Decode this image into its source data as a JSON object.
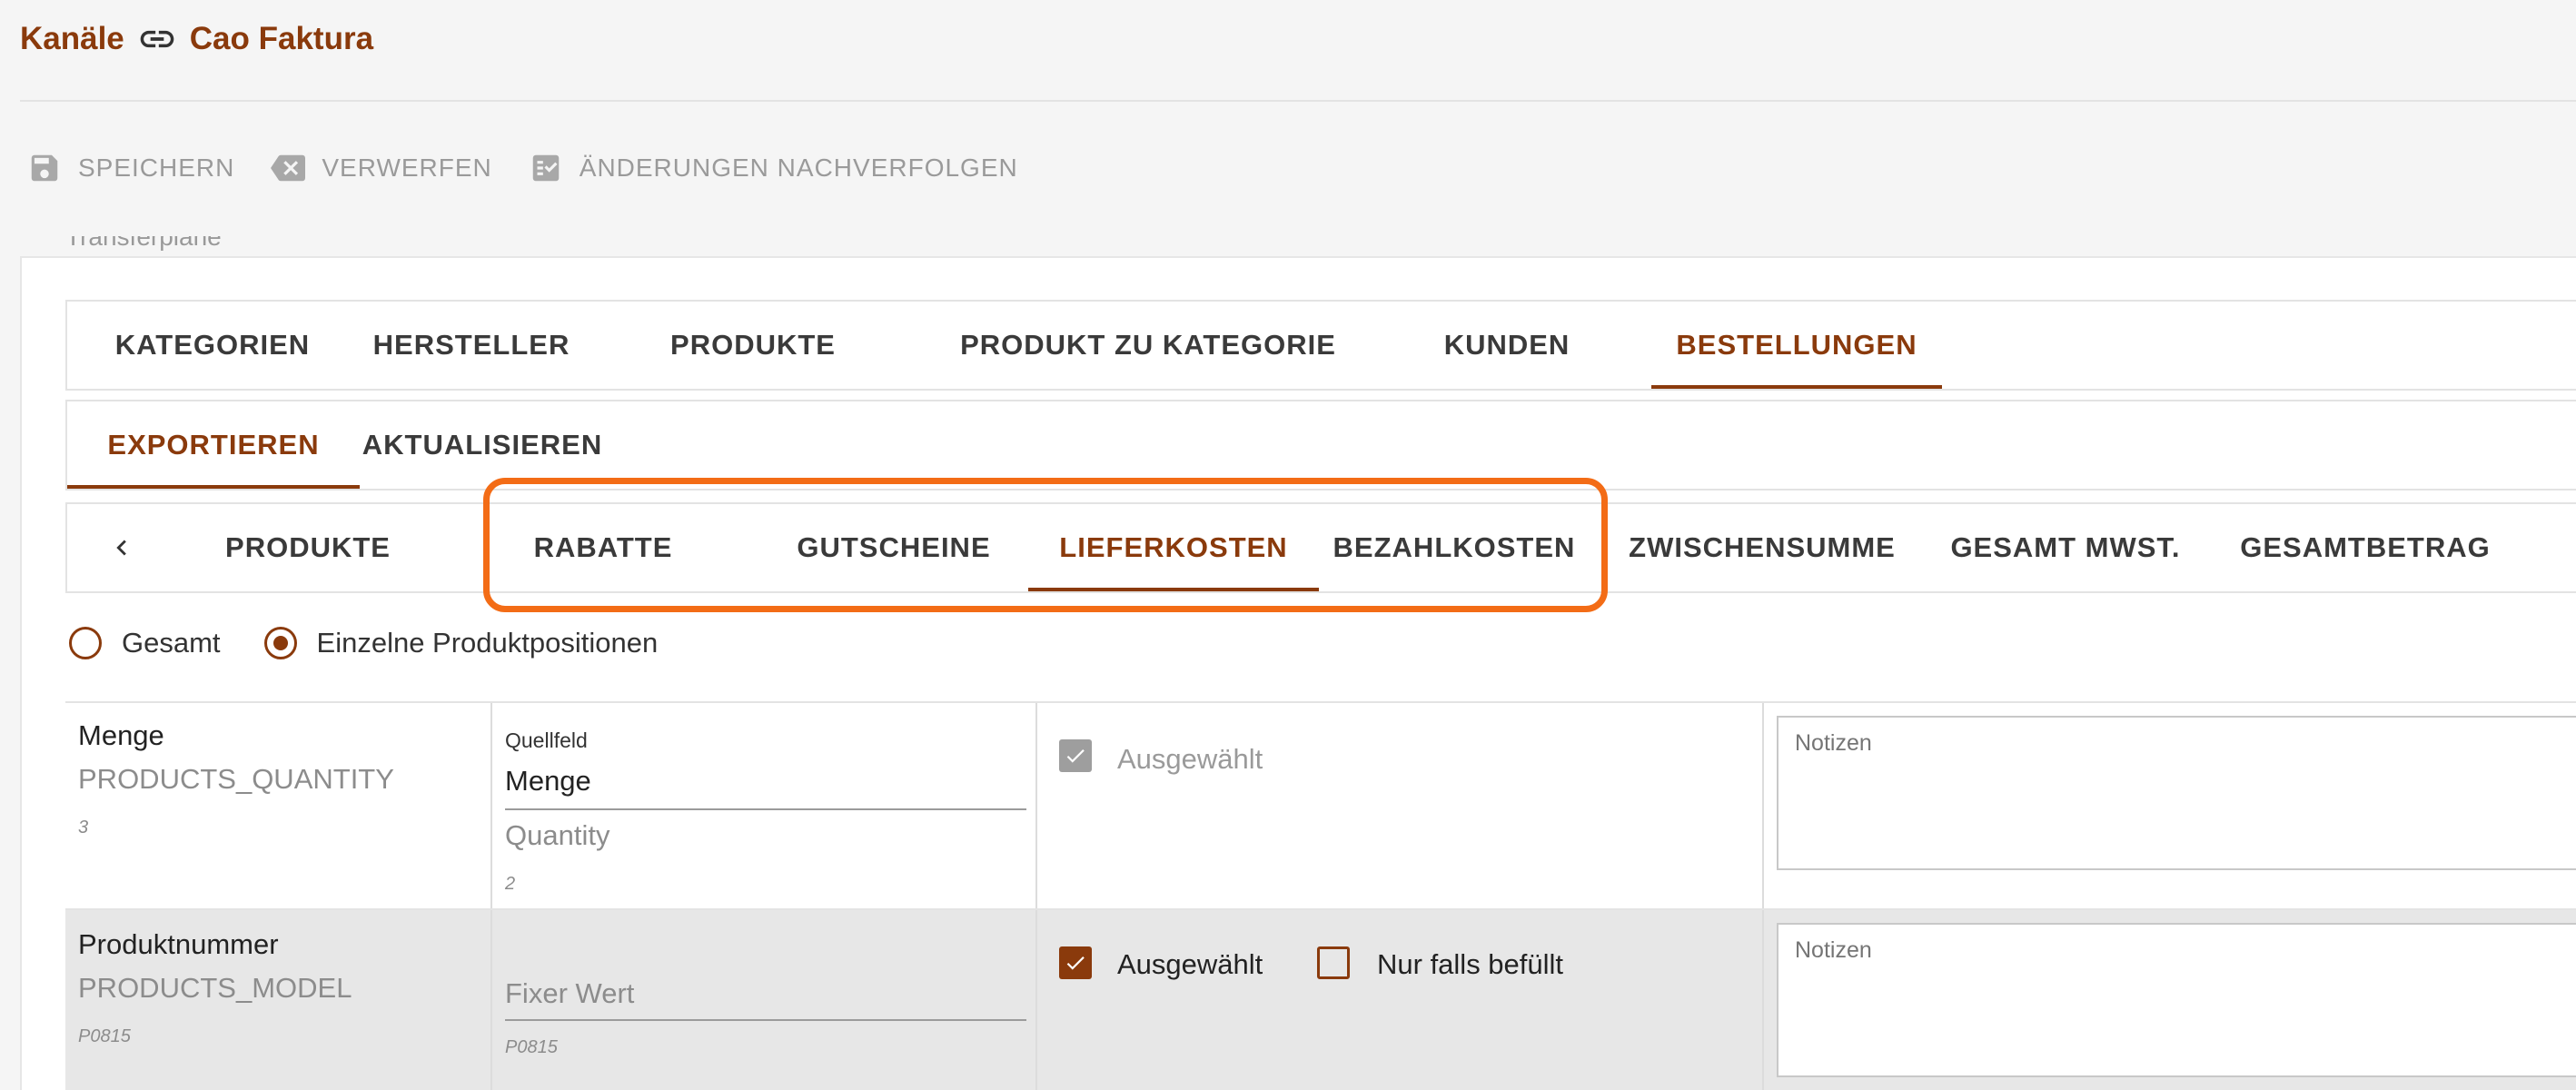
{
  "header": {
    "channel": "Kanäle",
    "connector": "Cao Faktura",
    "link_icon": "link-icon"
  },
  "toolbar": {
    "save": "SPEICHERN",
    "discard": "VERWERFEN",
    "track": "ÄNDERUNGEN NACHVERFOLGEN"
  },
  "card": {
    "cut_title": "Transferpläne"
  },
  "tabs_main": {
    "items": [
      "KATEGORIEN",
      "HERSTELLER",
      "PRODUKTE",
      "PRODUKT ZU KATEGORIE",
      "KUNDEN",
      "BESTELLUNGEN"
    ],
    "active": "BESTELLUNGEN"
  },
  "tabs_mode": {
    "items": [
      "EXPORTIEREN",
      "AKTUALISIEREN"
    ],
    "active": "EXPORTIEREN"
  },
  "tabs_order": {
    "items": [
      "PRODUKTE",
      "RABATTE",
      "GUTSCHEINE",
      "LIEFERKOSTEN",
      "BEZAHLKOSTEN",
      "ZWISCHENSUMME",
      "GESAMT MWST.",
      "GESAMTBETRAG"
    ],
    "active": "LIEFERKOSTEN"
  },
  "radios": {
    "total": "Gesamt",
    "positions": "Einzelne Produktpositionen",
    "selected": "Einzelne Produktpositionen"
  },
  "rows": [
    {
      "name": "Menge",
      "key": "PRODUCTS_QUANTITY",
      "sample": "3",
      "source_label": "Quellfeld",
      "source_value": "Menge",
      "source_placeholder": "Quantity",
      "source_sample": "2",
      "selected_label": "Ausgewählt",
      "selected": true,
      "selected_disabled": true,
      "notes_placeholder": "Notizen"
    },
    {
      "name": "Produktnummer",
      "key": "PRODUCTS_MODEL",
      "sample": "P0815",
      "source_placeholder": "Fixer Wert",
      "source_sample": "P0815",
      "selected_label": "Ausgewählt",
      "selected": true,
      "only_if_label": "Nur falls befüllt",
      "only_if": false,
      "notes_placeholder": "Notizen"
    }
  ],
  "colors": {
    "accent": "#8a3a0c",
    "highlight": "#f36c16",
    "muted": "#9a9a9a"
  }
}
